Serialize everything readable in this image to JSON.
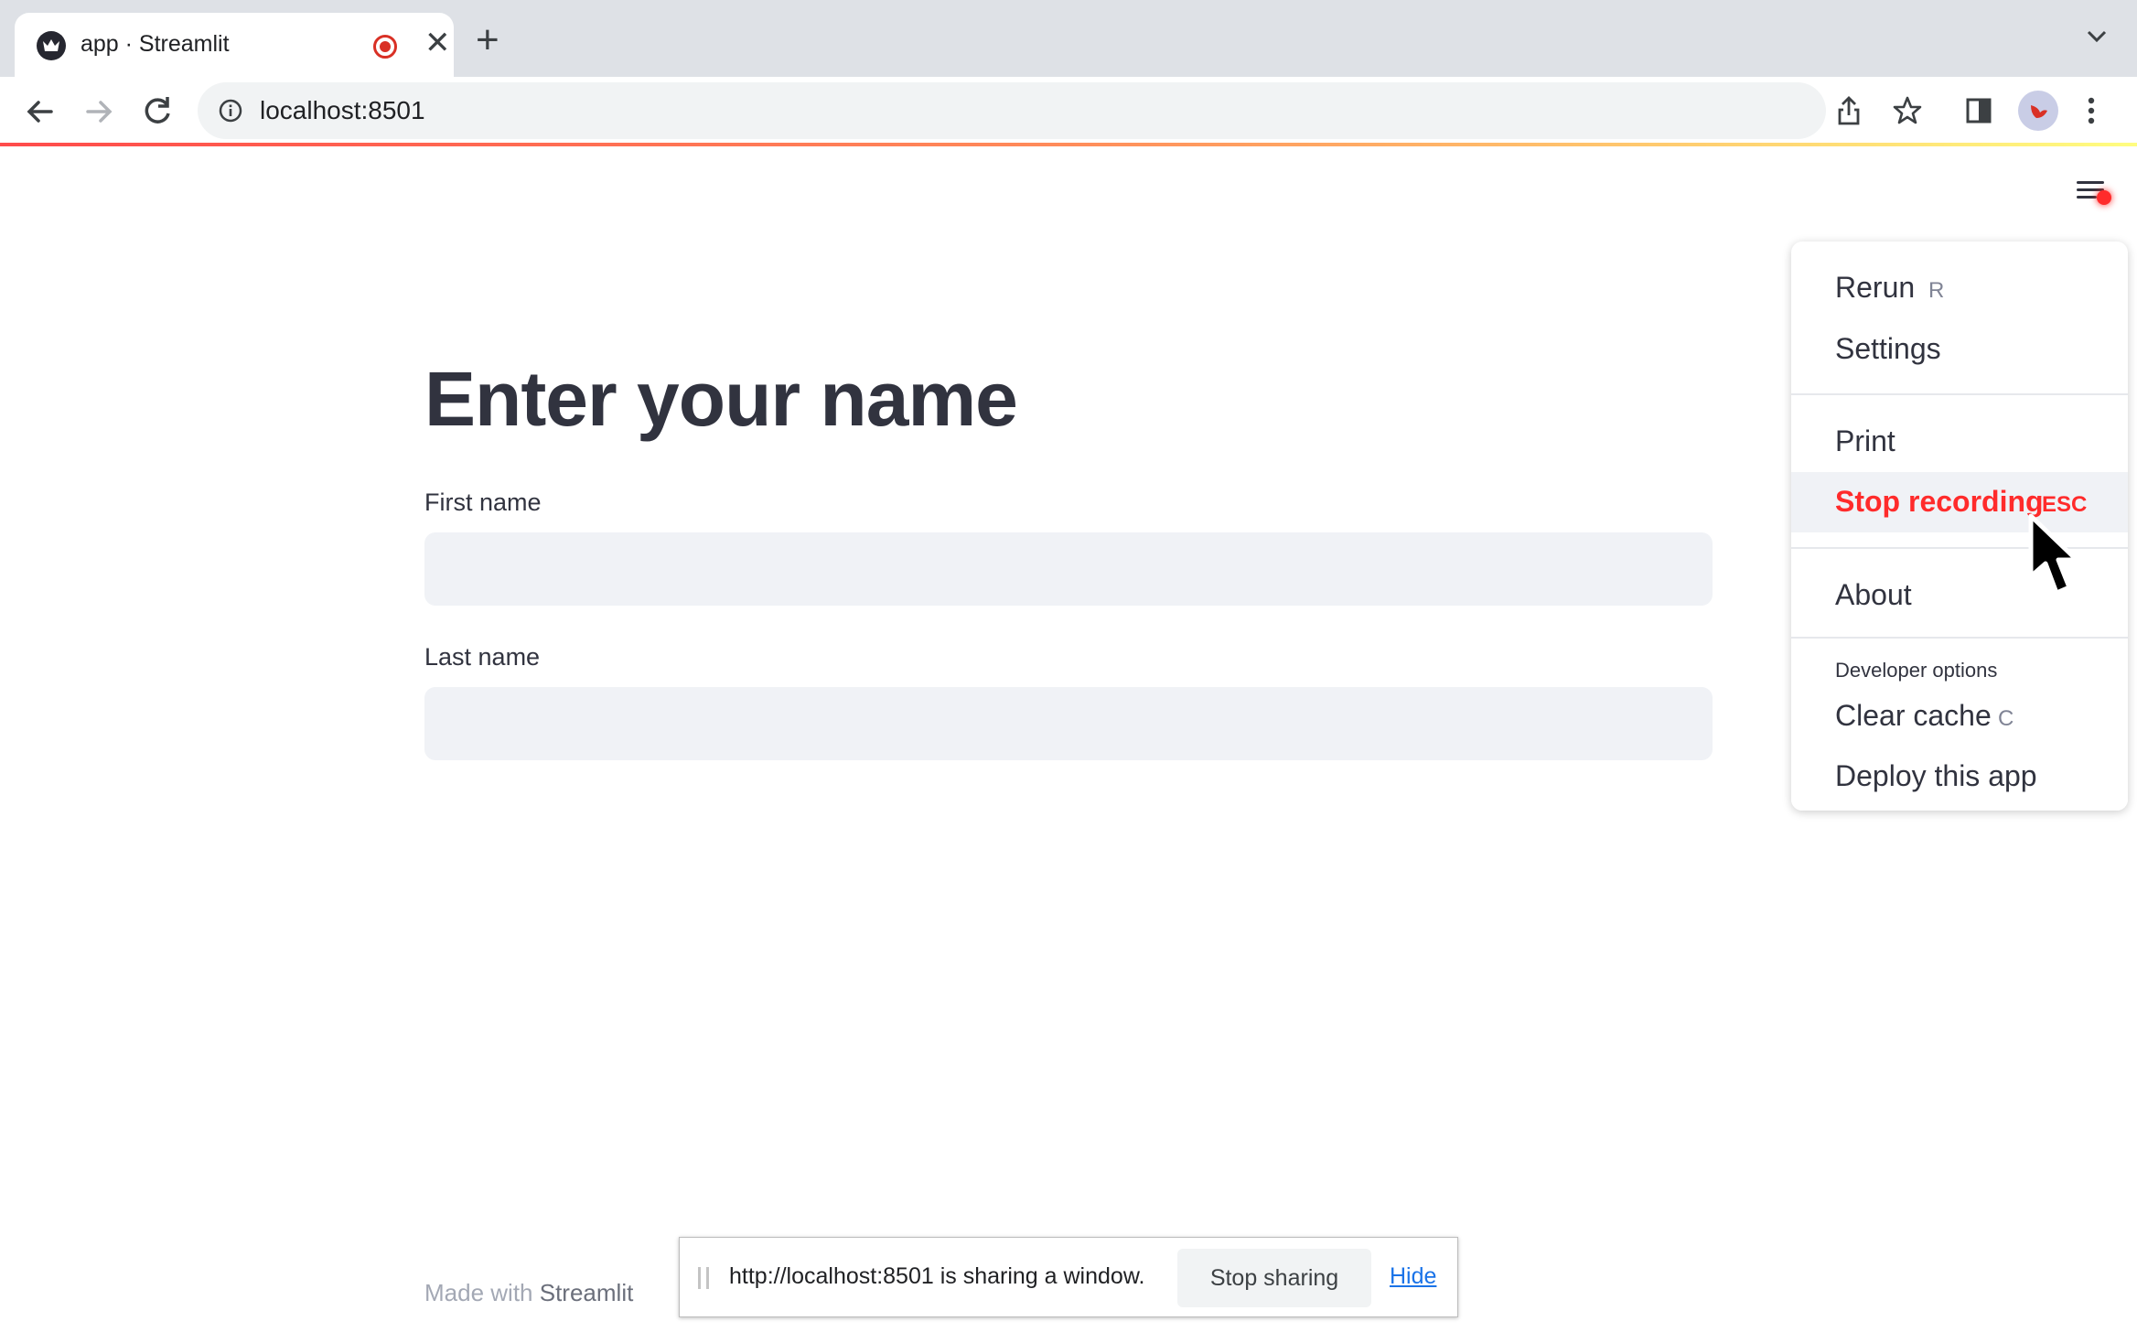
{
  "browser": {
    "tab_title": "app · Streamlit",
    "address": "localhost:8501",
    "new_tab_label": "+",
    "tab_close_label": "✕"
  },
  "app": {
    "title": "Enter your name",
    "fields": [
      {
        "label": "First name",
        "value": ""
      },
      {
        "label": "Last name",
        "value": ""
      }
    ],
    "footer_prefix": "Made with ",
    "footer_brand": "Streamlit"
  },
  "menu": {
    "items": [
      {
        "label": "Rerun",
        "shortcut": "R"
      },
      {
        "label": "Settings",
        "shortcut": ""
      },
      {
        "label": "Print",
        "shortcut": ""
      },
      {
        "label": "Stop recording",
        "shortcut": "ESC"
      },
      {
        "label": "About",
        "shortcut": ""
      }
    ],
    "developer_heading": "Developer options",
    "developer_items": [
      {
        "label": "Clear cache",
        "shortcut": "C"
      },
      {
        "label": "Deploy this app",
        "shortcut": ""
      }
    ],
    "active_item": "Stop recording"
  },
  "sharing_bar": {
    "message": "http://localhost:8501 is sharing a window.",
    "stop_label": "Stop sharing",
    "hide_label": "Hide"
  },
  "colors": {
    "accent_red": "#ff2b2b",
    "text_dark": "#31333f",
    "input_bg": "#f0f2f6",
    "link_blue": "#1a73e8"
  }
}
